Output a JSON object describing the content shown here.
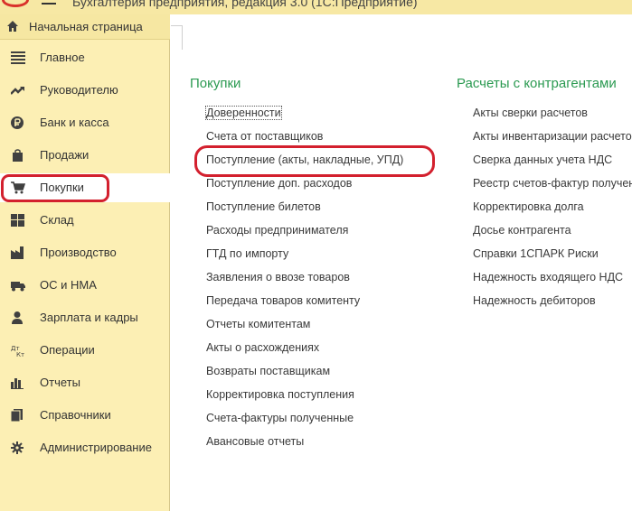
{
  "window": {
    "title": "Бухгалтерия предприятия, редакция 3.0 (1С:Предприятие)"
  },
  "colors": {
    "sidebar_bg": "#fcefb4",
    "section_title": "#2b9a51",
    "highlight": "#d3202e"
  },
  "sidebar": {
    "home": {
      "label": "Начальная страница",
      "icon": "home-icon"
    },
    "items": [
      {
        "label": "Главное",
        "icon": "list-icon"
      },
      {
        "label": "Руководителю",
        "icon": "trend-icon"
      },
      {
        "label": "Банк и касса",
        "icon": "coin-icon"
      },
      {
        "label": "Продажи",
        "icon": "bag-icon"
      },
      {
        "label": "Покупки",
        "icon": "cart-icon"
      },
      {
        "label": "Склад",
        "icon": "warehouse-icon"
      },
      {
        "label": "Производство",
        "icon": "factory-icon"
      },
      {
        "label": "ОС и НМА",
        "icon": "truck-icon"
      },
      {
        "label": "Зарплата и кадры",
        "icon": "person-icon"
      },
      {
        "label": "Операции",
        "icon": "debit-credit-icon"
      },
      {
        "label": "Отчеты",
        "icon": "bar-chart-icon"
      },
      {
        "label": "Справочники",
        "icon": "books-icon"
      },
      {
        "label": "Администрирование",
        "icon": "gear-icon"
      }
    ],
    "active": "Покупки"
  },
  "purchases": {
    "title": "Покупки",
    "links": [
      "Доверенности",
      "Счета от поставщиков",
      "Поступление (акты, накладные, УПД)",
      "Поступление доп. расходов",
      "Поступление билетов",
      "Расходы предпринимателя",
      "ГТД по импорту",
      "Заявления о ввозе товаров",
      "Передача товаров комитенту",
      "Отчеты комитентам",
      "Акты о расхождениях",
      "Возвраты поставщикам",
      "Корректировка поступления",
      "Счета-фактуры полученные",
      "Авансовые отчеты"
    ]
  },
  "settlements": {
    "title": "Расчеты с контрагентами",
    "links": [
      "Акты сверки расчетов",
      "Акты инвентаризации расчетов",
      "Сверка данных учета НДС",
      "Реестр счетов-фактур полученных",
      "Корректировка долга",
      "Досье контрагента",
      "Справки 1СПАРК Риски",
      "Надежность входящего НДС",
      "Надежность дебиторов"
    ]
  }
}
